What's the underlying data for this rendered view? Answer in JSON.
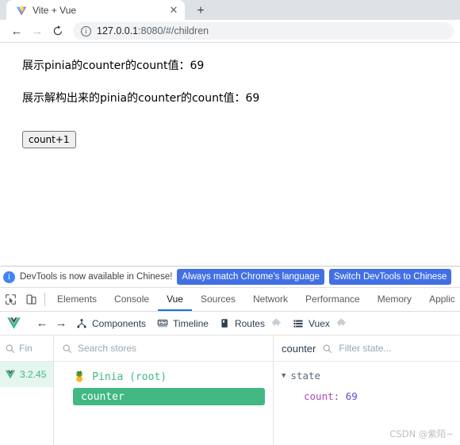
{
  "browser": {
    "tab": {
      "title": "Vite + Vue",
      "favicon_icon": "vite-logo-icon",
      "close_icon": "close-icon"
    },
    "new_tab_icon": "plus-icon",
    "nav": {
      "back_icon": "arrow-left-icon",
      "forward_icon": "arrow-right-icon",
      "reload_icon": "reload-icon"
    },
    "omnibox": {
      "info_icon": "info-circle-icon",
      "url_host": "127.0.0.1",
      "url_port": ":8080",
      "url_path": "/#/children"
    }
  },
  "page": {
    "line1": "展示pinia的counter的count值：69",
    "line2": "展示解构出来的pinia的counter的count值：69",
    "button_label": "count+1"
  },
  "devtools": {
    "notice": {
      "icon": "info-circle-icon",
      "text": "DevTools is now available in Chinese!",
      "primary_button": "Always match Chrome's language",
      "secondary_button": "Switch DevTools to Chinese"
    },
    "toolbar_icons": {
      "inspect": "inspect-element-icon",
      "device": "device-toolbar-icon"
    },
    "tabs": [
      {
        "label": "Elements",
        "active": false
      },
      {
        "label": "Console",
        "active": false
      },
      {
        "label": "Vue",
        "active": true
      },
      {
        "label": "Sources",
        "active": false
      },
      {
        "label": "Network",
        "active": false
      },
      {
        "label": "Performance",
        "active": false
      },
      {
        "label": "Memory",
        "active": false
      },
      {
        "label": "Applic",
        "active": false
      }
    ],
    "accent_color": "#1a73e8"
  },
  "vue_devtools": {
    "logo_icon": "vue-logo-icon",
    "back_icon": "arrow-left-icon",
    "forward_icon": "arrow-right-icon",
    "nav_items": [
      {
        "label": "Components",
        "icon": "components-tree-icon",
        "plugin": false
      },
      {
        "label": "Timeline",
        "icon": "timeline-icon",
        "plugin": false
      },
      {
        "label": "Routes",
        "icon": "routes-book-icon",
        "plugin": true
      },
      {
        "label": "Vuex",
        "icon": "vuex-list-icon",
        "plugin": true
      }
    ],
    "plugin_icon": "puzzle-piece-icon",
    "versions_panel": {
      "search_icon": "search-icon",
      "search_placeholder": "Fin",
      "version_label": "3.2.45",
      "version_icon": "vue-logo-icon"
    },
    "stores_panel": {
      "search_icon": "search-icon",
      "search_placeholder": "Search stores",
      "root_label": "Pinia (root)",
      "root_icon": "pineapple-icon",
      "selected_store": "counter",
      "brand_color": "#42b883"
    },
    "state_panel": {
      "title": "counter",
      "search_icon": "search-icon",
      "filter_placeholder": "Filter state...",
      "caret_icon": "chevron-down-icon",
      "group_label": "state",
      "entry_key": "count",
      "entry_colon": ":",
      "entry_value": "69"
    },
    "watermark": "CSDN @紫陌~"
  }
}
